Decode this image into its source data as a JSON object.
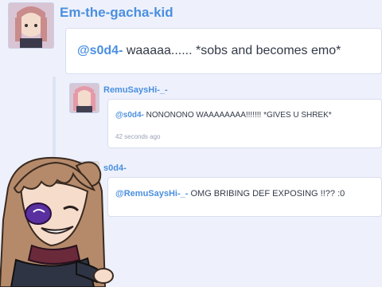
{
  "thread": {
    "comments": [
      {
        "username": "Em-the-gacha-kid",
        "mention": "@s0d4-",
        "text": " waaaaa...... *sobs and becomes emo*"
      },
      {
        "username": "RemuSaysHi-_-",
        "mention": "@s0d4-",
        "text": " NONONONO WAAAAAAAA!!!!!!! *GIVES U SHREK*",
        "timestamp": "42 seconds ago"
      },
      {
        "username": "s0d4-",
        "mention": "@RemuSaysHi-_-",
        "text": " OMG BRIBING DEF EXPOSING !!?? :0"
      }
    ]
  },
  "colors": {
    "accent": "#4a8fe0",
    "thread_background": "#eef1fb",
    "bubble": "#ffffff"
  }
}
